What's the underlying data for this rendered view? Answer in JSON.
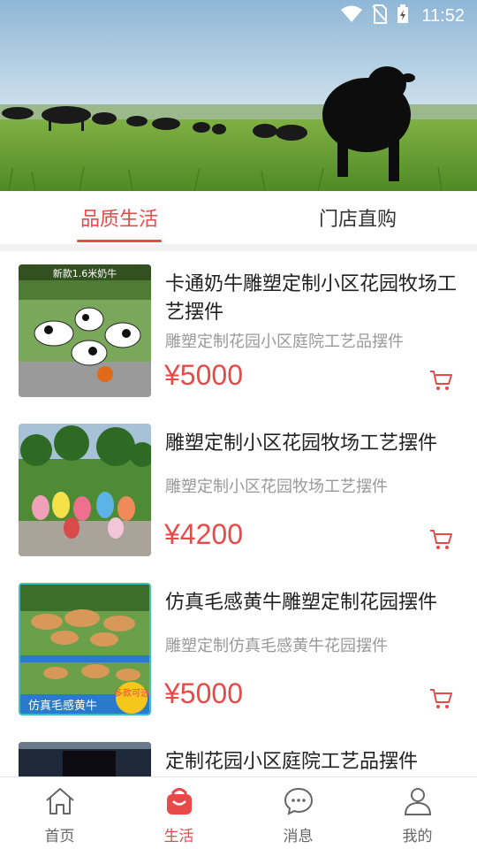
{
  "status_bar": {
    "time": "11:52",
    "icons": [
      "wifi-icon",
      "no-sim-icon",
      "battery-charging-icon"
    ]
  },
  "hero": {
    "image": "black cattle grazing on green pasture"
  },
  "tabs": [
    {
      "label": "品质生活",
      "active": true
    },
    {
      "label": "门店直购",
      "active": false
    }
  ],
  "products": [
    {
      "title": "卡通奶牛雕塑定制小区花园牧场工艺摆件",
      "subtitle": "雕塑定制花园小区庭院工艺品摆件",
      "price": "¥5000",
      "image_overlay_text": "新款1.6米奶牛"
    },
    {
      "title": "雕塑定制小区花园牧场工艺摆件",
      "subtitle": "雕塑定制小区花园牧场工艺摆件",
      "price": "¥4200"
    },
    {
      "title": "仿真毛感黄牛雕塑定制花园摆件",
      "subtitle": "雕塑定制仿真毛感黄牛花园摆件",
      "price": "¥5000",
      "image_overlay_text": "仿真毛感黄牛",
      "image_badge": "多款可选"
    },
    {
      "title": "定制花园小区庭院工艺品摆件"
    }
  ],
  "bottom_nav": [
    {
      "label": "首页",
      "icon": "home-icon",
      "active": false
    },
    {
      "label": "生活",
      "icon": "shopping-bag-icon",
      "active": true
    },
    {
      "label": "消息",
      "icon": "chat-bubble-icon",
      "active": false
    },
    {
      "label": "我的",
      "icon": "user-icon",
      "active": false
    }
  ],
  "colors": {
    "accent": "#e84a4a",
    "text_primary": "#222222",
    "text_secondary": "#999999",
    "divider": "#f2f2f2"
  }
}
